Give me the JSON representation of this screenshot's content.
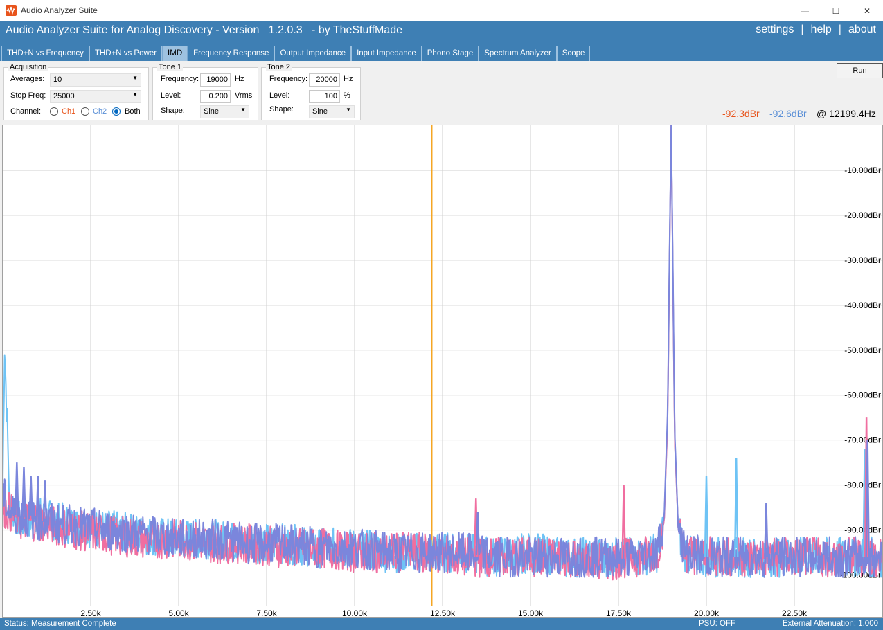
{
  "window": {
    "title": "Audio Analyzer Suite",
    "minimize_glyph": "—",
    "maximize_glyph": "☐",
    "close_glyph": "✕"
  },
  "header": {
    "title": "Audio Analyzer Suite for Analog Discovery - Version   1.2.0.3   - by TheStuffMade",
    "links": {
      "settings": "settings",
      "help": "help",
      "about": "about",
      "separator": "|"
    }
  },
  "tabs": [
    {
      "label": "THD+N vs Frequency",
      "active": false
    },
    {
      "label": "THD+N vs Power",
      "active": false
    },
    {
      "label": "IMD",
      "active": true
    },
    {
      "label": "Frequency Response",
      "active": false
    },
    {
      "label": "Output Impedance",
      "active": false
    },
    {
      "label": "Input Impedance",
      "active": false
    },
    {
      "label": "Phono Stage",
      "active": false
    },
    {
      "label": "Spectrum Analyzer",
      "active": false
    },
    {
      "label": "Scope",
      "active": false
    }
  ],
  "acquisition": {
    "title": "Acquisition",
    "averages_label": "Averages:",
    "averages_value": "10",
    "stop_freq_label": "Stop Freq:",
    "stop_freq_value": "25000",
    "channel_label": "Channel:",
    "ch1": "Ch1",
    "ch2": "Ch2",
    "both": "Both",
    "selected_channel": "Both"
  },
  "tone1": {
    "title": "Tone 1",
    "frequency_label": "Frequency:",
    "frequency_value": "19000",
    "frequency_unit": "Hz",
    "level_label": "Level:",
    "level_value": "0.200",
    "level_unit": "Vrms",
    "shape_label": "Shape:",
    "shape_value": "Sine"
  },
  "tone2": {
    "title": "Tone 2",
    "frequency_label": "Frequency:",
    "frequency_value": "20000",
    "frequency_unit": "Hz",
    "level_label": "Level:",
    "level_value": "100",
    "level_unit": "%",
    "shape_label": "Shape:",
    "shape_value": "Sine"
  },
  "run_label": "Run",
  "readout": {
    "ch1": "-92.3dBr",
    "ch2": "-92.6dBr",
    "at": "@ 12199.4Hz"
  },
  "colors": {
    "ch1": "#f06ea0",
    "ch2": "#6ec3f5",
    "combined": "#7b86dc",
    "ch1_readout": "#e8541c",
    "ch2_readout": "#5a8fd6",
    "cursor": "#f5a623",
    "header_blue": "#3e7fb4"
  },
  "chart_data": {
    "type": "line",
    "xlim": [
      0,
      25000
    ],
    "ylim": [
      -107,
      0
    ],
    "x_ticks": [
      {
        "value": 2500,
        "label": "2.50k"
      },
      {
        "value": 5000,
        "label": "5.00k"
      },
      {
        "value": 7500,
        "label": "7.50k"
      },
      {
        "value": 10000,
        "label": "10.00k"
      },
      {
        "value": 12500,
        "label": "12.50k"
      },
      {
        "value": 15000,
        "label": "15.00k"
      },
      {
        "value": 17500,
        "label": "17.50k"
      },
      {
        "value": 20000,
        "label": "20.00k"
      },
      {
        "value": 22500,
        "label": "22.50k"
      }
    ],
    "y_ticks": [
      {
        "value": -10,
        "label": "-10.00dBr"
      },
      {
        "value": -20,
        "label": "-20.00dBr"
      },
      {
        "value": -30,
        "label": "-30.00dBr"
      },
      {
        "value": -40,
        "label": "-40.00dBr"
      },
      {
        "value": -50,
        "label": "-50.00dBr"
      },
      {
        "value": -60,
        "label": "-60.00dBr"
      },
      {
        "value": -70,
        "label": "-70.00dBr"
      },
      {
        "value": -80,
        "label": "-80.00dBr"
      },
      {
        "value": -90,
        "label": "-90.00dBr"
      },
      {
        "value": -100,
        "label": "-100.00dBr"
      }
    ],
    "cursor_x": 12199.4,
    "grid": true,
    "series": [
      {
        "key": "ch2",
        "x": [
          0,
          50,
          200,
          500,
          1000,
          2000,
          3000,
          4000,
          5000,
          6000,
          7000,
          8000,
          9000,
          10000,
          11000,
          12000,
          13000,
          14000,
          15000,
          16000,
          17000,
          18000,
          18600,
          18800,
          18900,
          18950,
          19000,
          19050,
          19100,
          19200,
          19400,
          19600,
          20000,
          20500,
          21000,
          22000,
          23000,
          24000,
          24500,
          25000
        ],
        "y": [
          -80,
          -48,
          -85,
          -88,
          -87,
          -89,
          -90,
          -91,
          -92,
          -92,
          -93,
          -93,
          -94,
          -94,
          -95,
          -95,
          -95,
          -96,
          -95,
          -96,
          -96,
          -96,
          -95,
          -88,
          -65,
          -30,
          0,
          -35,
          -70,
          -90,
          -95,
          -96,
          -96,
          -96,
          -96,
          -96,
          -96,
          -96,
          -96,
          -96
        ]
      },
      {
        "key": "ch1",
        "x": [
          0,
          200,
          500,
          1000,
          2000,
          3000,
          4000,
          5000,
          6000,
          7000,
          8000,
          9000,
          10000,
          11000,
          12000,
          13000,
          14000,
          15000,
          16000,
          17000,
          18000,
          18600,
          18800,
          18900,
          18950,
          19000,
          19050,
          19100,
          19200,
          19400,
          20000,
          21000,
          22000,
          23000,
          24000,
          24500,
          25000
        ],
        "y": [
          -85,
          -86,
          -88,
          -88,
          -90,
          -91,
          -92,
          -92,
          -93,
          -93,
          -94,
          -94,
          -95,
          -95,
          -95,
          -96,
          -96,
          -96,
          -96,
          -97,
          -96,
          -95,
          -88,
          -65,
          -30,
          0,
          -35,
          -70,
          -90,
          -95,
          -96,
          -96,
          -96,
          -96,
          -96,
          -96,
          -96
        ]
      },
      {
        "key": "combined",
        "x": [
          0,
          200,
          500,
          1000,
          2000,
          3000,
          4000,
          5000,
          6000,
          7000,
          8000,
          9000,
          10000,
          11000,
          12000,
          13000,
          14000,
          15000,
          16000,
          17000,
          18000,
          18600,
          18800,
          18900,
          18950,
          19000,
          19050,
          19100,
          19200,
          19400,
          20000,
          21000,
          22000,
          23000,
          24000,
          24500,
          25000
        ],
        "y": [
          -82,
          -86,
          -87,
          -88,
          -89,
          -90,
          -91,
          -92,
          -92,
          -93,
          -93,
          -94,
          -94,
          -95,
          -95,
          -95,
          -96,
          -96,
          -96,
          -96,
          -96,
          -95,
          -87,
          -63,
          -28,
          0,
          -33,
          -68,
          -90,
          -95,
          -96,
          -96,
          -96,
          -96,
          -96,
          -96,
          -96
        ]
      }
    ],
    "spikes": [
      {
        "key": "ch2",
        "x": 20000,
        "y": -78
      },
      {
        "key": "ch2",
        "x": 20850,
        "y": -74
      },
      {
        "key": "ch2",
        "x": 24500,
        "y": -72
      },
      {
        "key": "ch1",
        "x": 13450,
        "y": -83
      },
      {
        "key": "ch1",
        "x": 17650,
        "y": -80
      },
      {
        "key": "ch1",
        "x": 24550,
        "y": -65
      },
      {
        "key": "combined",
        "x": 13500,
        "y": -86
      },
      {
        "key": "combined",
        "x": 21700,
        "y": -84
      },
      {
        "key": "combined",
        "x": 24580,
        "y": -70
      },
      {
        "key": "combined",
        "x": 400,
        "y": -75
      },
      {
        "key": "combined",
        "x": 600,
        "y": -76
      },
      {
        "key": "combined",
        "x": 800,
        "y": -78
      },
      {
        "key": "combined",
        "x": 1000,
        "y": -78
      },
      {
        "key": "combined",
        "x": 1200,
        "y": -79
      }
    ]
  },
  "status": {
    "left": "Status: Measurement Complete",
    "psu": "PSU: OFF",
    "attenuation": "External Attenuation: 1.000"
  }
}
